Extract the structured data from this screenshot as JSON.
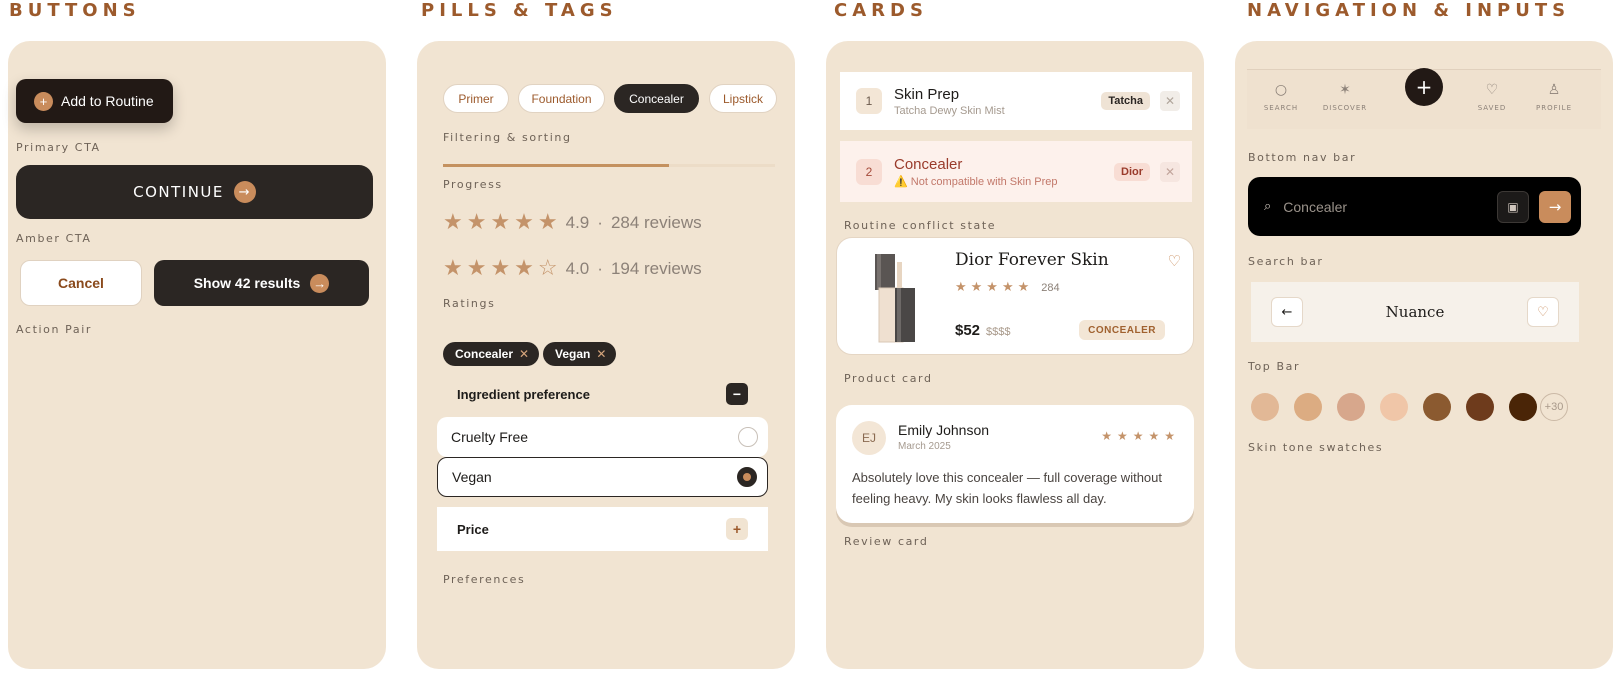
{
  "sections": {
    "buttons": "BUTTONS",
    "pills": "PILLS & TAGS",
    "cards": "CARDS",
    "nav": "NAVIGATION & INPUTS"
  },
  "buttons_panel": {
    "add_routine": {
      "icon": "+",
      "label": "Add to Routine"
    },
    "primary_caption": "Primary CTA",
    "continue": {
      "label": "CONTINUE",
      "icon": "→"
    },
    "amber_caption": "Amber CTA",
    "cancel": "Cancel",
    "show_results": {
      "label": "Show 42 results",
      "icon": "→"
    },
    "action_caption": "Action Pair"
  },
  "pills_panel": {
    "pills": [
      "Primer",
      "Foundation",
      "Concealer",
      "Lipstick"
    ],
    "active_pill": "Concealer",
    "filtering_caption": "Filtering & sorting",
    "progress": 0.68,
    "progress_caption": "Progress",
    "ratings": [
      {
        "stars": "★★★★★",
        "score": "4.9",
        "sep": "·",
        "reviews": "284 reviews"
      },
      {
        "stars": "★★★★☆",
        "score": "4.0",
        "sep": "·",
        "reviews": "194 reviews"
      }
    ],
    "ratings_caption": "Ratings",
    "chips": [
      {
        "label": "Concealer",
        "remove": "✕"
      },
      {
        "label": "Vegan",
        "remove": "✕"
      }
    ],
    "ingredient": {
      "title": "Ingredient preference",
      "toggle": "−"
    },
    "options": [
      {
        "label": "Cruelty Free",
        "selected": false
      },
      {
        "label": "Vegan",
        "selected": true
      }
    ],
    "price": {
      "title": "Price",
      "toggle": "+"
    },
    "preferences_caption": "Preferences"
  },
  "cards_panel": {
    "routine": [
      {
        "num": "1",
        "title": "Skin Prep",
        "subtitle": "Tatcha Dewy Skin Mist",
        "brand": "Tatcha",
        "close": "✕"
      },
      {
        "num": "2",
        "title": "Concealer",
        "subtitle": "⚠️ Not compatible with Skin Prep",
        "brand": "Dior",
        "close": "✕"
      }
    ],
    "conflict_caption": "Routine conflict state",
    "product": {
      "name": "Dior Forever Skin",
      "stars": "★★★★★",
      "count": "284",
      "price": "$52",
      "price_tier": "$$$$",
      "tag": "CONCEALER",
      "heart": "♡"
    },
    "product_caption": "Product card",
    "review": {
      "initials": "EJ",
      "name": "Emily Johnson",
      "date": "March 2025",
      "stars": "★★★★★",
      "text": "Absolutely love this concealer — full coverage without feeling heavy. My skin looks flawless all day."
    },
    "review_caption": "Review card"
  },
  "nav_panel": {
    "nav_items": [
      {
        "icon": "search-icon",
        "glyph": "○",
        "label": "SEARCH"
      },
      {
        "icon": "sparkle-icon",
        "glyph": "✶",
        "label": "DISCOVER"
      },
      {
        "icon": "heart-icon",
        "glyph": "♡",
        "label": "SAVED"
      },
      {
        "icon": "profile-icon",
        "glyph": "♙",
        "label": "PROFILE"
      }
    ],
    "fab": "+",
    "bottom_caption": "Bottom nav bar",
    "search": {
      "icon": "⌕",
      "value": "Concealer",
      "scan": "▣",
      "go": "→"
    },
    "search_caption": "Search bar",
    "topbar": {
      "back": "←",
      "title": "Nuance",
      "heart": "♡"
    },
    "topbar_caption": "Top Bar",
    "swatches": [
      "#e2b896",
      "#dcac82",
      "#d7a78c",
      "#f0c6a8",
      "#8b5a30",
      "#6e3b1c",
      "#4a2507"
    ],
    "swatch_more": "+30",
    "swatch_caption": "Skin tone swatches"
  },
  "colors": {
    "panel_bg": "#f1e4d2",
    "dark": "#2b2623",
    "amber": "#c98c5c",
    "brown_text": "#9c5a2c"
  }
}
